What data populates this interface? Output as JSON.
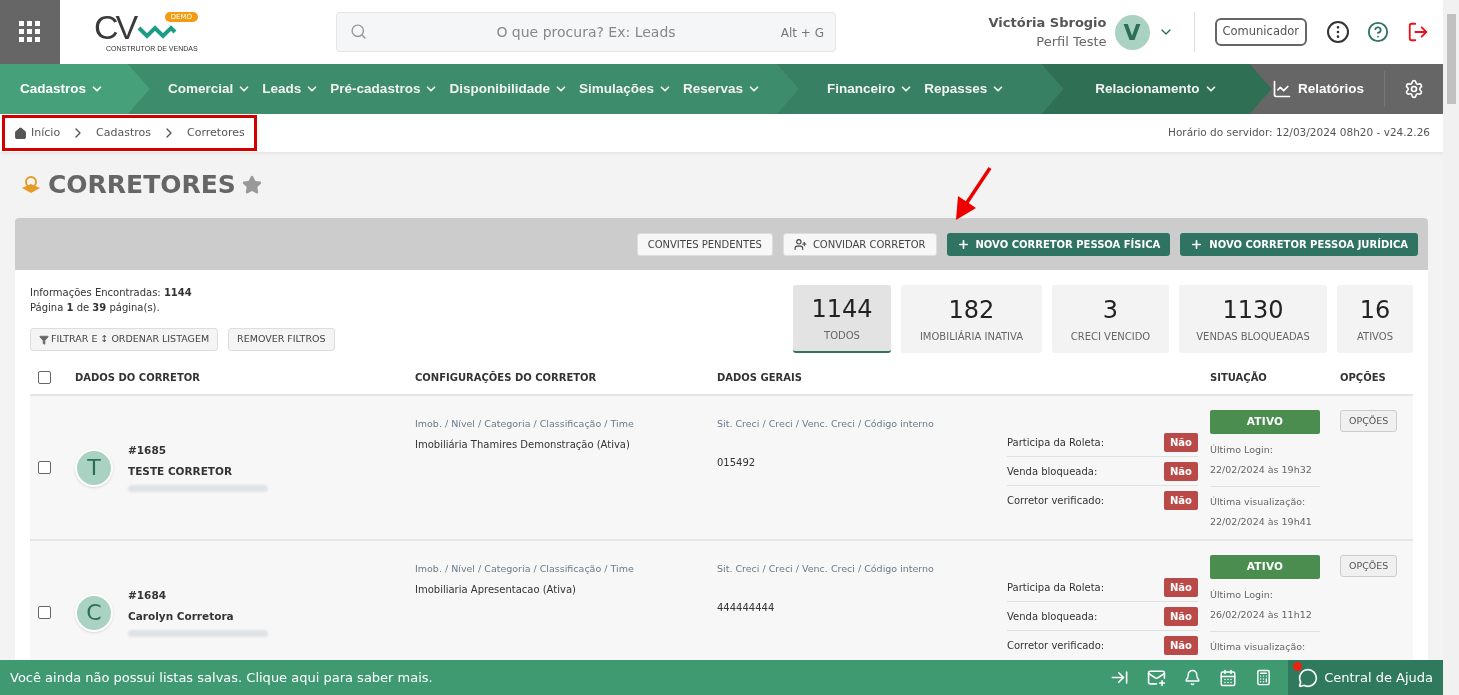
{
  "header": {
    "logo": {
      "mark": "CV",
      "badge": "DEMO",
      "tagline": "CONSTRUTOR DE VENDAS"
    },
    "search": {
      "placeholder": "O que procura? Ex: Leads",
      "shortcut": "Alt + G"
    },
    "user": {
      "name": "Victória Sbrogio",
      "profile": "Perfil Teste",
      "initial": "V"
    },
    "communicator": "Comunicador"
  },
  "nav": {
    "groups": [
      {
        "items": [
          "Cadastros"
        ],
        "active": true
      },
      {
        "items": [
          "Comercial",
          "Leads",
          "Pré-cadastros",
          "Disponibilidade",
          "Simulações",
          "Reservas"
        ],
        "active": false
      },
      {
        "items": [
          "Financeiro",
          "Repasses"
        ],
        "active": false
      },
      {
        "items": [
          "Relacionamento"
        ],
        "active": false
      }
    ],
    "reports": "Relatórios"
  },
  "breadcrumb": {
    "items": [
      "Início",
      "Cadastros",
      "Corretores"
    ],
    "highlighted": true
  },
  "server_time": "Horário do servidor: 12/03/2024 08h20 - v24.2.26",
  "page": {
    "title": "CORRETORES",
    "favorite": false
  },
  "toolbar": [
    {
      "label": "CONVITES PENDENTES",
      "kind": "plain"
    },
    {
      "label": "CONVIDAR CORRETOR",
      "kind": "invite"
    },
    {
      "label": "NOVO CORRETOR PESSOA FÍSICA",
      "kind": "primary"
    },
    {
      "label": "NOVO CORRETOR PESSOA JURÍDICA",
      "kind": "primary"
    }
  ],
  "summary": {
    "found": "Informações Encontradas: **1144**",
    "pages": "Página **1** de **39** página(s)."
  },
  "filters": [
    {
      "label": "FILTRAR E ↕ ORDENAR LISTAGEM",
      "kind": "filter"
    },
    {
      "label": "REMOVER FILTROS",
      "kind": "plain"
    }
  ],
  "stats": [
    {
      "value": "1144",
      "label": "TODOS",
      "selected": true
    },
    {
      "value": "182",
      "label": "IMOBILIÁRIA INATIVA",
      "selected": false
    },
    {
      "value": "3",
      "label": "CRECI VENCIDO",
      "selected": false
    },
    {
      "value": "1130",
      "label": "VENDAS BLOQUEADAS",
      "selected": false
    },
    {
      "value": "16",
      "label": "ATIVOS",
      "selected": false
    }
  ],
  "table": {
    "select_all": false,
    "columns": [
      "DADOS DO CORRETOR",
      "CONFIGURAÇÕES DO CORRETOR",
      "DADOS GERAIS",
      "SITUAÇÃO",
      "OPÇÕES"
    ],
    "rows": [
      {
        "checked": false,
        "initial": "T",
        "id": "#1685",
        "name": "TESTE CORRETOR",
        "config_label": "Imob. / Nível / Categoria / Classificação / Time",
        "config": "Imobiliária Thamires Demonstração (Ativa)",
        "general_label": "Sit. Creci / Creci / Venc. Creci / Código interno",
        "general": "015492",
        "flags": [
          {
            "label": "Participa da Roleta:",
            "value": "Não"
          },
          {
            "label": "Venda bloqueada:",
            "value": "Não"
          },
          {
            "label": "Corretor verificado:",
            "value": "Não"
          }
        ],
        "status": "ATIVO",
        "activity": [
          {
            "label": "Último Login:",
            "date": "22/02/2024 às 19h32"
          },
          {
            "label": "Última visualização:",
            "date": "22/02/2024 às 19h41"
          }
        ],
        "options": "OPÇÕES"
      },
      {
        "checked": false,
        "initial": "C",
        "id": "#1684",
        "name": "Carolyn Corretora",
        "config_label": "Imob. / Nível / Categoria / Classificação / Time",
        "config": "Imobiliaria Apresentacao (Ativa)",
        "general_label": "Sit. Creci / Creci / Venc. Creci / Código interno",
        "general": "444444444",
        "flags": [
          {
            "label": "Participa da Roleta:",
            "value": "Não"
          },
          {
            "label": "Venda bloqueada:",
            "value": "Não"
          },
          {
            "label": "Corretor verificado:",
            "value": "Não"
          }
        ],
        "status": "ATIVO",
        "activity": [
          {
            "label": "Último Login:",
            "date": "26/02/2024 às 11h12"
          },
          {
            "label": "Última visualização:"
          }
        ],
        "options": "OPÇÕES"
      }
    ]
  },
  "footer": {
    "message": "Você ainda não possui listas salvas. Clique aqui para saber mais.",
    "help": "Central de Ajuda",
    "help_notification": true
  }
}
